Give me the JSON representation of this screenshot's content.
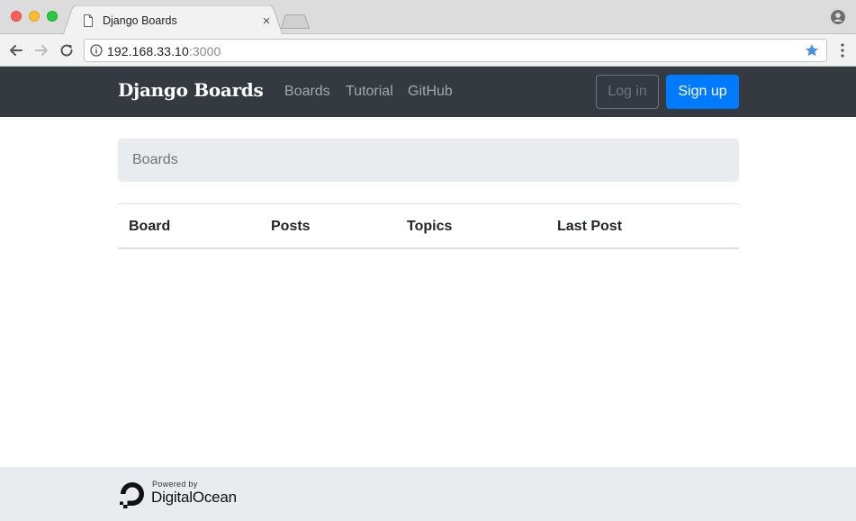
{
  "browser": {
    "tab_title": "Django Boards",
    "tab_close": "×",
    "url_host": "192.168.33.10",
    "url_port": ":3000"
  },
  "navbar": {
    "brand": "Django Boards",
    "links": [
      "Boards",
      "Tutorial",
      "GitHub"
    ],
    "login_label": "Log in",
    "signup_label": "Sign up"
  },
  "breadcrumb": {
    "items": [
      "Boards"
    ]
  },
  "table": {
    "headers": [
      "Board",
      "Posts",
      "Topics",
      "Last Post"
    ],
    "rows": []
  },
  "footer": {
    "powered_by": "Powered by",
    "company": "DigitalOcean"
  },
  "colors": {
    "navbar_bg": "#343a40",
    "primary": "#007bff",
    "breadcrumb_bg": "#e9ecef",
    "footer_bg": "#e9ecef"
  }
}
